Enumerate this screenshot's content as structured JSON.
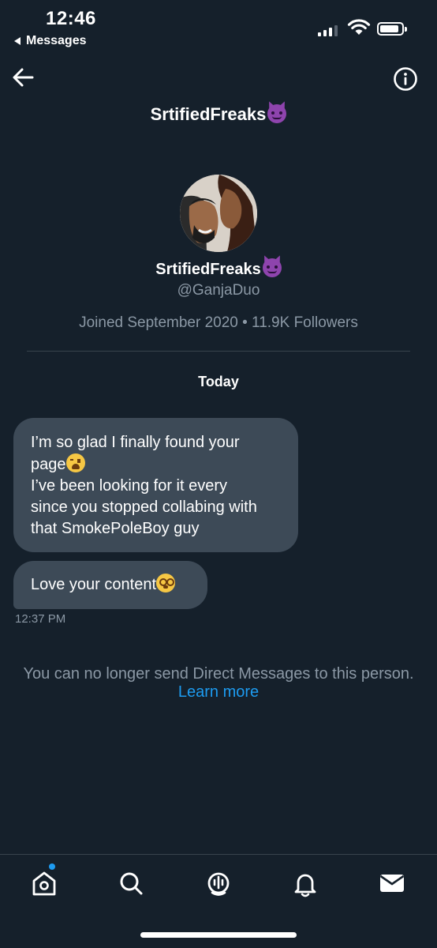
{
  "status_bar": {
    "time": "12:46",
    "back_app": "Messages"
  },
  "header": {
    "title": "SrtifiedFreaks",
    "title_emoji": "smiling-imp"
  },
  "profile": {
    "name": "SrtifiedFreaks",
    "name_emoji": "smiling-imp",
    "handle": "@GanjaDuo",
    "meta": "Joined September 2020 • 11.9K Followers"
  },
  "conversation": {
    "day_label": "Today",
    "messages": [
      {
        "lines": [
          "I’m so glad I finally found your",
          "page",
          "I’ve been looking for it every",
          "since you stopped collabing with",
          "that SmokePoleBoy guy"
        ],
        "emoji": "weary-face"
      },
      {
        "lines": [
          "Love your content"
        ],
        "emoji": "dizzy-face"
      }
    ],
    "last_time": "12:37 PM",
    "notice": "You can no longer send Direct Messages to this person.",
    "learn_more": "Learn more"
  },
  "tabbar": {
    "items": [
      "home-icon",
      "search-icon",
      "spaces-icon",
      "notifications-icon",
      "messages-icon"
    ],
    "active": "messages-icon",
    "home_badge": true
  },
  "colors": {
    "background": "#15202b",
    "bubble": "#3d4a57",
    "secondary_text": "#8b98a5",
    "link": "#1d9bf0"
  }
}
